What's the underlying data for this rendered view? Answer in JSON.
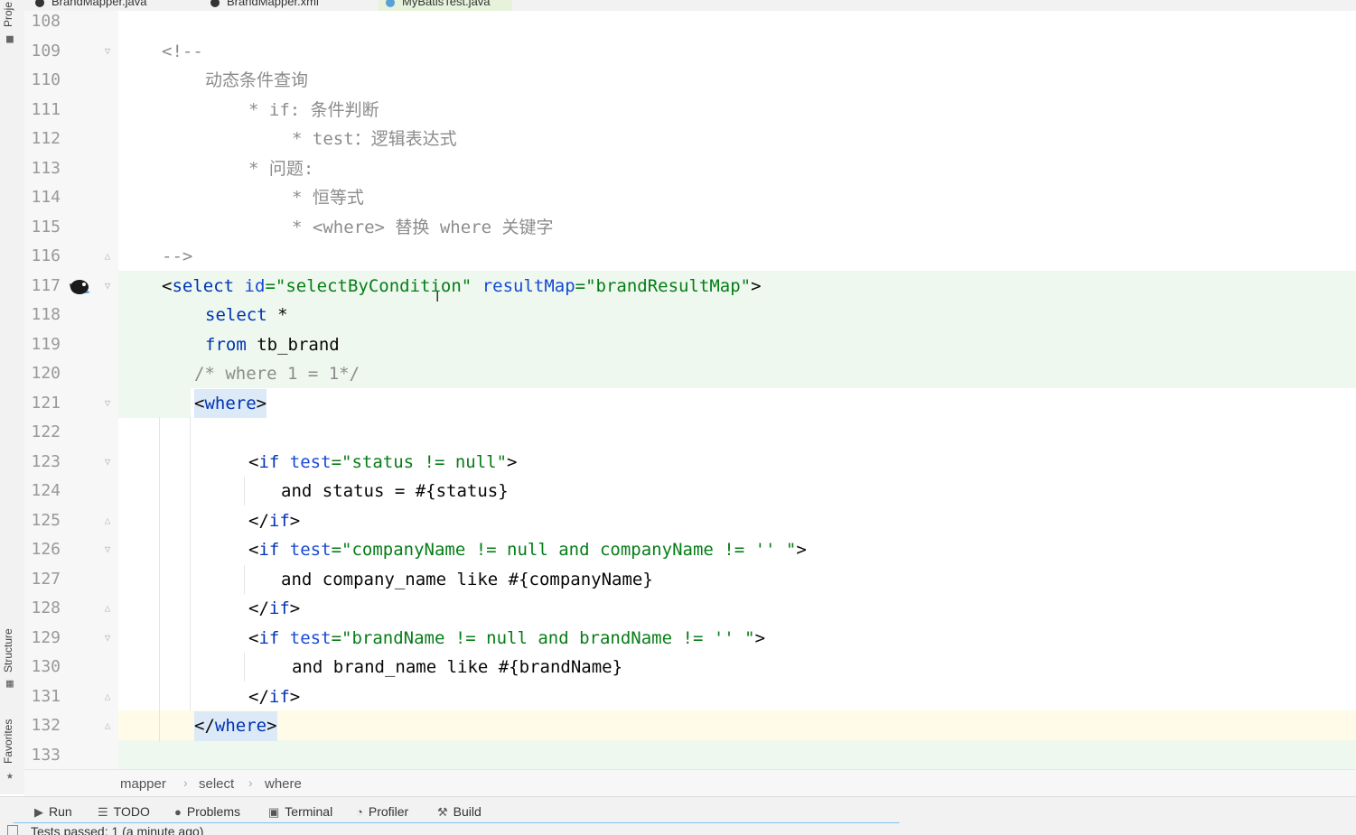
{
  "tabs": [
    {
      "label": "BrandMapper.java"
    },
    {
      "label": "BrandMapper.xml"
    },
    {
      "label": "MyBatisTest.java"
    }
  ],
  "left_panel": {
    "project_label": "Proje",
    "structure_label": "Structure",
    "favorites_label": "Favorites"
  },
  "lines": [
    {
      "num": "108"
    },
    {
      "num": "109",
      "text": "<!--"
    },
    {
      "num": "110",
      "text": "动态条件查询"
    },
    {
      "num": "111",
      "text": "* if: 条件判断"
    },
    {
      "num": "112",
      "text": "* test：逻辑表达式"
    },
    {
      "num": "113",
      "text": "* 问题:"
    },
    {
      "num": "114",
      "text": "* 恒等式"
    },
    {
      "num": "115",
      "text": "* <where> 替换 where 关键字"
    },
    {
      "num": "116",
      "text": "-->"
    },
    {
      "num": "117",
      "open": "<",
      "tag": "select",
      "sp1": " ",
      "a1": "id",
      "eq1": "=",
      "v1": "\"selectByCondition\"",
      "sp2": " ",
      "a2": "resultMap",
      "eq2": "=",
      "v2": "\"brandResultMap\"",
      "close": ">"
    },
    {
      "num": "118",
      "kw": "select",
      "rest": " *"
    },
    {
      "num": "119",
      "kw": "from",
      "rest": " tb_brand"
    },
    {
      "num": "120",
      "text": "/* where 1 = 1*/"
    },
    {
      "num": "121",
      "open": "<",
      "tag": "where",
      "close": ">"
    },
    {
      "num": "122"
    },
    {
      "num": "123",
      "open": "<",
      "tag": "if",
      "sp1": " ",
      "a1": "test",
      "eq1": "=",
      "v1": "\"status != null\"",
      "close": ">"
    },
    {
      "num": "124",
      "text": "and status = #{status}"
    },
    {
      "num": "125",
      "open": "</",
      "tag": "if",
      "close": ">"
    },
    {
      "num": "126",
      "open": "<",
      "tag": "if",
      "sp1": " ",
      "a1": "test",
      "eq1": "=",
      "v1": "\"companyName != null and companyName != '' \"",
      "close": ">"
    },
    {
      "num": "127",
      "text": "and company_name like #{companyName}"
    },
    {
      "num": "128",
      "open": "</",
      "tag": "if",
      "close": ">"
    },
    {
      "num": "129",
      "open": "<",
      "tag": "if",
      "sp1": " ",
      "a1": "test",
      "eq1": "=",
      "v1": "\"brandName != null and brandName != '' \"",
      "close": ">"
    },
    {
      "num": "130",
      "text": "and brand_name like #{brandName}"
    },
    {
      "num": "131",
      "open": "</",
      "tag": "if",
      "close": ">"
    },
    {
      "num": "132",
      "open": "</",
      "tag": "where",
      "close": ">"
    },
    {
      "num": "133"
    }
  ],
  "breadcrumb": [
    "mapper",
    "select",
    "where"
  ],
  "toolbar": {
    "run": "Run",
    "todo": "TODO",
    "problems": "Problems",
    "terminal": "Terminal",
    "profiler": "Profiler",
    "build": "Build"
  },
  "status": {
    "text": "Tests passed: 1 (a minute ago)"
  },
  "icons": [
    "folder-icon",
    "structure-icon",
    "star-icon",
    "mybatis-bird-icon",
    "play-icon",
    "list-icon",
    "problems-icon",
    "terminal-icon",
    "profiler-icon",
    "hammer-icon"
  ]
}
